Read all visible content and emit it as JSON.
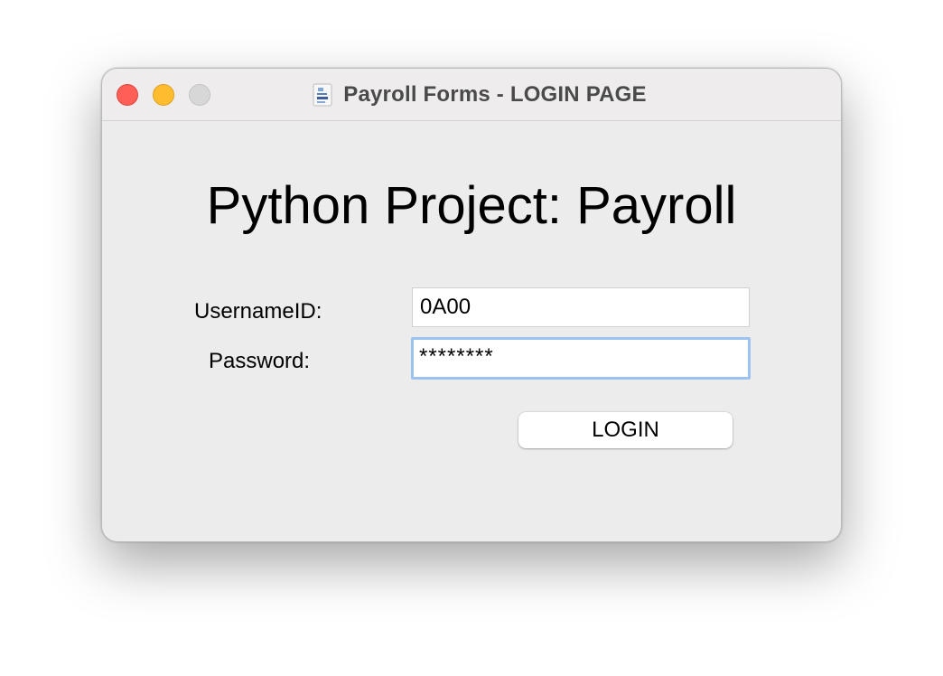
{
  "window": {
    "title": "Payroll Forms - LOGIN PAGE",
    "title_icon": "document-icon"
  },
  "heading": "Python Project: Payroll",
  "form": {
    "username_label": "UsernameID:",
    "username_value": "0A00",
    "password_label": "Password:",
    "password_value": "********",
    "login_label": "LOGIN"
  },
  "colors": {
    "close": "#ff5f57",
    "minimize": "#febc2e",
    "zoom": "#d7d7d7",
    "focus_ring": "#9cc2ef",
    "window_bg": "#ececec"
  }
}
